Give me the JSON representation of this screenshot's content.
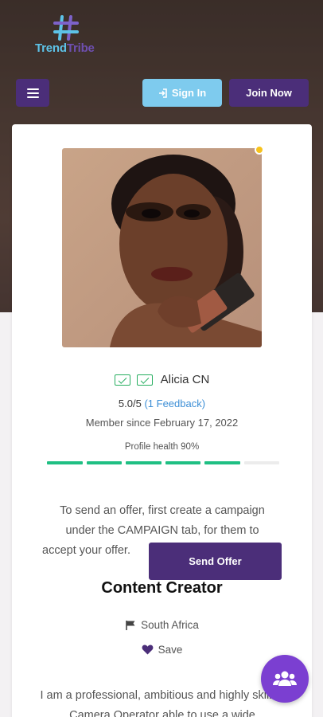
{
  "brand": {
    "part1": "Trend",
    "part2": "Tribe"
  },
  "header": {
    "signin_label": "Sign In",
    "join_label": "Join Now"
  },
  "profile": {
    "name": "Alicia CN",
    "rating": "5.0/5",
    "feedback": "(1 Feedback)",
    "member_since": "Member since February 17, 2022",
    "health_label": "Profile health 90%",
    "health_value": 0.9,
    "status_color": "#f7c21b"
  },
  "offer": {
    "line1": "To send an offer, first create a campaign",
    "line2": "under the CAMPAIGN tab, for them to",
    "line3": "accept your offer.",
    "button": "Send Offer"
  },
  "role": "Content Creator",
  "country": "South Africa",
  "save_label": "Save",
  "bio": "I am a professional, ambitious and highly skilled Camera Operator able to use a wide",
  "colors": {
    "primary": "#4b2e79",
    "accent": "#7ecbee",
    "health": "#1fbf83",
    "fab": "#7b3fd1"
  }
}
